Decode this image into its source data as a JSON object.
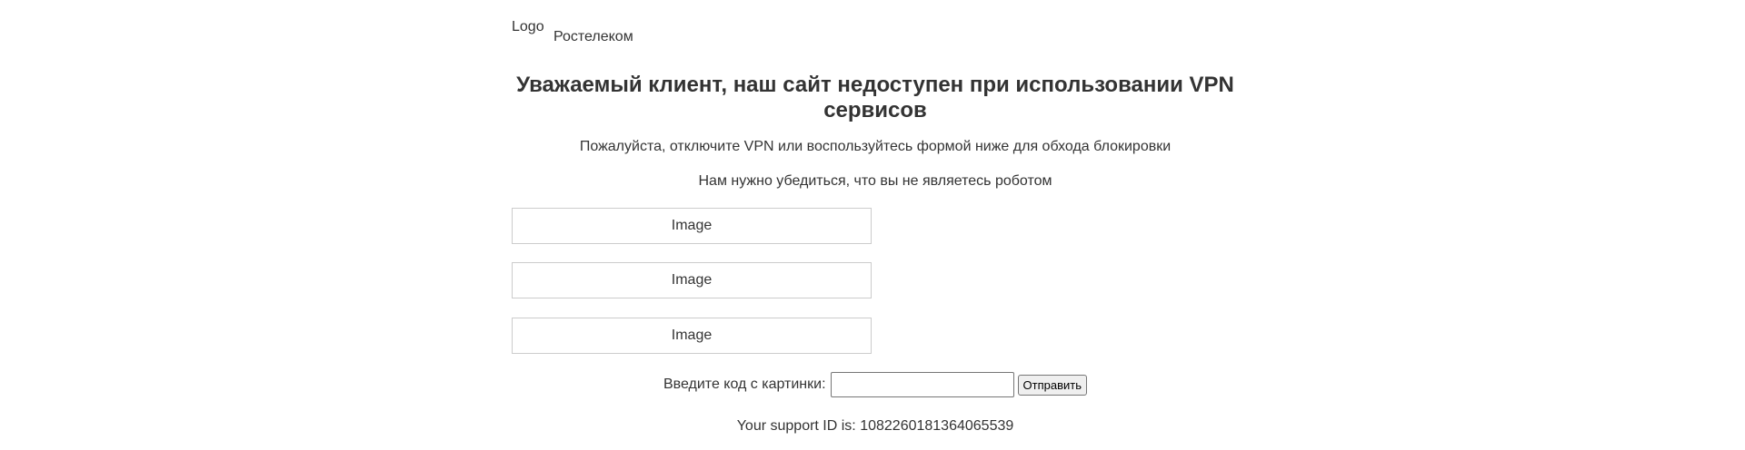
{
  "header": {
    "logo_alt": "Logo",
    "brand": "Ростелеком"
  },
  "main": {
    "title": "Уважаемый клиент, наш сайт недоступен при использовании VPN сервисов",
    "subtitle": "Пожалуйста, отключите VPN или воспользуйтесь формой ниже для обхода блокировки",
    "robot_check": "Нам нужно убедиться, что вы не являетесь роботом",
    "captcha_images": [
      "Image",
      "Image",
      "Image"
    ]
  },
  "form": {
    "label": "Введите код с картинки:",
    "input_value": "",
    "submit_label": "Отправить"
  },
  "footer": {
    "support_id": "Your support ID is: 1082260181364065539"
  }
}
